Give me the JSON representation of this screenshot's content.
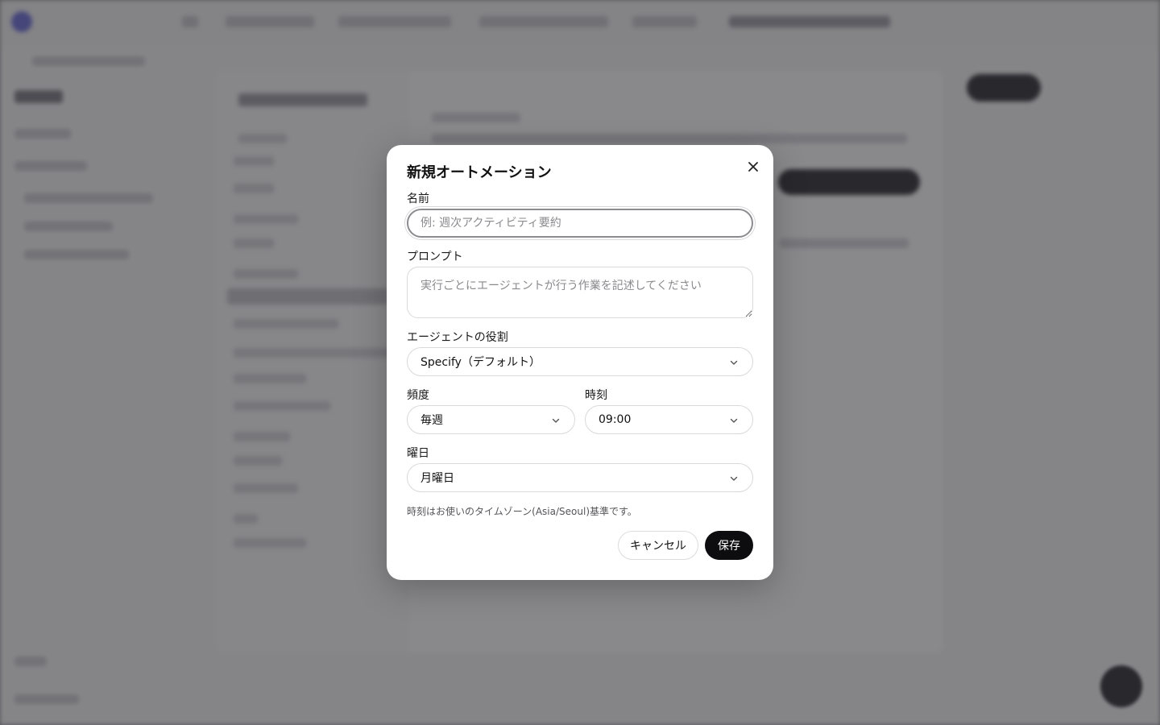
{
  "modal": {
    "title": "新規オートメーション",
    "name_label": "名前",
    "name_value": "",
    "name_placeholder": "例: 週次アクティビティ要約",
    "prompt_label": "プロンプト",
    "prompt_value": "",
    "prompt_placeholder": "実行ごとにエージェントが行う作業を記述してください",
    "role_label": "エージェントの役割",
    "role_value": "Specify（デフォルト）",
    "frequency_label": "頻度",
    "frequency_value": "毎週",
    "time_label": "時刻",
    "time_value": "09:00",
    "weekday_label": "曜日",
    "weekday_value": "月曜日",
    "timezone_hint": "時刻はお使いのタイムゾーン(Asia/Seoul)基準です。",
    "cancel_label": "キャンセル",
    "save_label": "保存"
  },
  "icons": {
    "close": "close-icon",
    "chevron": "chevron-down-icon"
  },
  "colors": {
    "primary_button": "#0d0d10",
    "overlay": "#28282e"
  }
}
